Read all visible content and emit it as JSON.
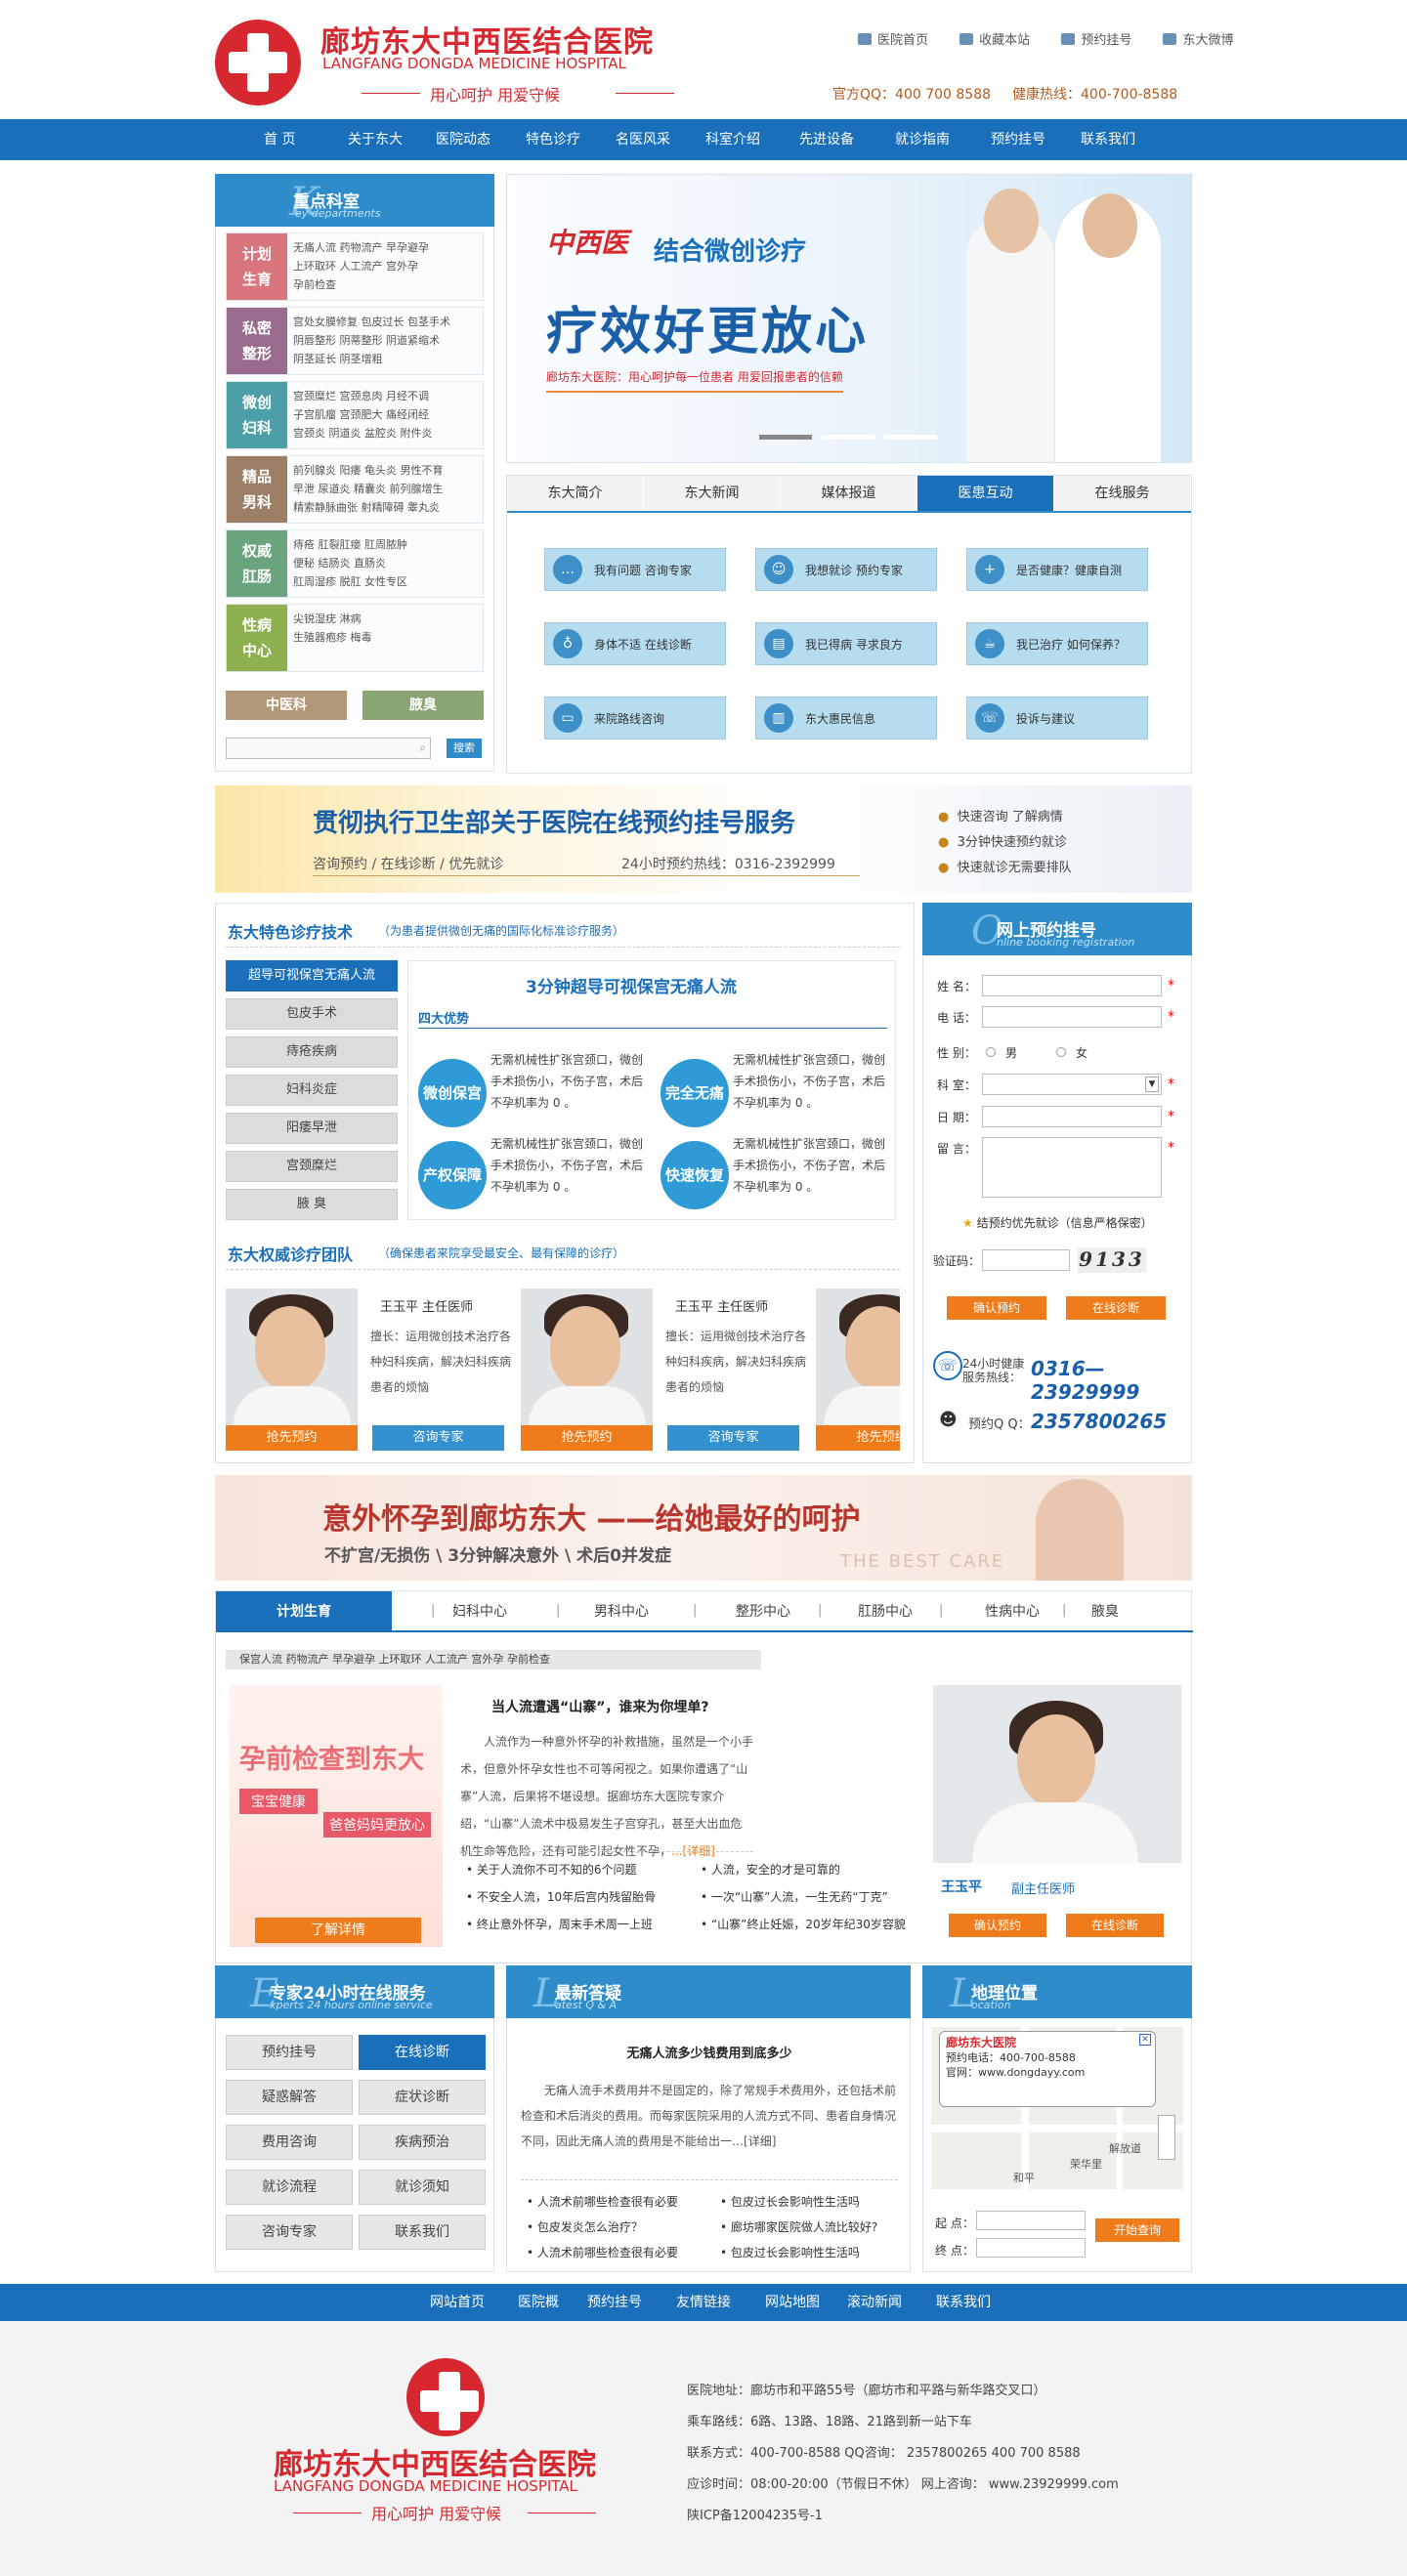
{
  "header": {
    "logo_cn": "廊坊东大中西医结合医院",
    "logo_en": "LANGFANG DONGDA  MEDICINE HOSPITAL",
    "slogan": "用心呵护   用爱守候",
    "links": [
      "医院首页",
      "收藏本站",
      "预约挂号",
      "东大微博"
    ],
    "qq": "官方QQ：400 700 8588",
    "hotline": "健康热线：400-700-8588"
  },
  "nav": [
    "首 页",
    "关于东大",
    "医院动态",
    "特色诊疗",
    "名医风采",
    "科室介绍",
    "先进设备",
    "就诊指南",
    "预约挂号",
    "联系我们"
  ],
  "key_depts": {
    "title": "重点科室",
    "letter": "K",
    "en": "ey departments",
    "items": [
      {
        "tag": "计划生育",
        "color": "#d9757d",
        "lines": [
          "无痛人流  药物流产  早孕避孕",
          "上环取环  人工流产  宫外孕",
          "孕前检查"
        ]
      },
      {
        "tag": "私密整形",
        "color": "#9a6b8c",
        "lines": [
          "宫处女膜修复 包皮过长 包茎手术",
          "阴唇整形   阴蒂整形   阴道紧缩术",
          "阴茎延长   阴茎增粗"
        ]
      },
      {
        "tag": "微创妇科",
        "color": "#4ea0a8",
        "lines": [
          "宫颈糜烂   宫颈息肉   月经不调",
          "子宫肌瘤   宫颈肥大   痛经闭经",
          "宫颈炎     阴道炎     盆腔炎     附件炎"
        ]
      },
      {
        "tag": "精品男科",
        "color": "#9b7e63",
        "lines": [
          "前列腺炎 阳痿 龟头炎 男性不育",
          "早泄 尿道炎 精囊炎 前列腺增生",
          "精索静脉曲张 射精障碍 睾丸炎"
        ]
      },
      {
        "tag": "权威肛肠",
        "color": "#6aa47e",
        "lines": [
          "痔疮   肛裂肛瘘   肛周脓肿",
          "便秘   结肠炎     直肠炎",
          "肛周湿疹   脱肛   女性专区"
        ]
      },
      {
        "tag": "性病中心",
        "color": "#8fb04e",
        "lines": [
          "尖锐湿疣   淋病",
          "生殖器疱疹   梅毒"
        ]
      }
    ],
    "btn_zy": "中医科",
    "btn_hx": "腋臭",
    "search_btn": "搜索"
  },
  "banner": {
    "brand": "中西医",
    "line1": "结合微创诊疗",
    "line2": "疗效好更放心",
    "line3": "廊坊东大医院：用心呵护每一位患者    用爱回报患者的信赖"
  },
  "tabs": [
    "东大简介",
    "东大新闻",
    "媒体报道",
    "医患互动",
    "在线服务"
  ],
  "interact": [
    [
      "我有问题  咨询专家",
      "我想就诊  预约专家",
      "是否健康？健康自测"
    ],
    [
      "身体不适  在线诊断",
      "我已得病  寻求良方",
      "我已治疗  如何保养？"
    ],
    [
      "来院路线咨询",
      "东大惠民信息",
      "投诉与建议"
    ]
  ],
  "mid_banner": {
    "title": "贯彻执行卫生部关于医院在线预约挂号服务",
    "sub": "咨询预约   /   在线诊断   /   优先就诊",
    "hot": "24小时预约热线：0316-2392999",
    "bullets": [
      "快速咨询 了解病情",
      "3分钟快速预约就诊",
      "快速就诊无需要排队"
    ]
  },
  "special": {
    "title": "东大特色诊疗技术",
    "sub": "（为患者提供微创无痛的国际化标准诊疗服务）",
    "tabs": [
      "超导可视保宫无痛人流",
      "包皮手术",
      "痔疮疾病",
      "妇科炎症",
      "阳痿早泄",
      "宫颈糜烂",
      "腋    臭"
    ],
    "headline": "3分钟超导可视保宫无痛人流",
    "adv_title": "四大优势",
    "advs": [
      {
        "name": "微创保宫",
        "txt": "无需机械性扩张宫颈口，微创手术损伤小，不伤子宫，术后不孕机率为 0 。"
      },
      {
        "name": "完全无痛",
        "txt": "无需机械性扩张宫颈口，微创手术损伤小，不伤子宫，术后不孕机率为 0 。"
      },
      {
        "name": "产权保障",
        "txt": "无需机械性扩张宫颈口，微创手术损伤小，不伤子宫，术后不孕机率为 0 。"
      },
      {
        "name": "快速恢复",
        "txt": "无需机械性扩张宫颈口，微创手术损伤小，不伤子宫，术后不孕机率为 0 。"
      }
    ]
  },
  "team": {
    "title": "东大权威诊疗团队",
    "sub": "（确保患者来院享受最安全、最有保障的诊疗）",
    "doctors": [
      {
        "name": "王玉平   主任医师",
        "desc": "擅长：运用微创技术治疗各种妇科疾病，解决妇科疾病患者的烦恼"
      },
      {
        "name": "王玉平   主任医师",
        "desc": "擅长：运用微创技术治疗各种妇科疾病，解决妇科疾病患者的烦恼"
      }
    ],
    "btn_book": "抢先预约",
    "btn_consult": "咨询专家"
  },
  "booking": {
    "title": "网上预约挂号",
    "letter": "O",
    "en": "nline booking registration",
    "labels": [
      "姓    名：",
      "电    话：",
      "性    别：",
      "科    室：",
      "日    期：",
      "留    言："
    ],
    "male": "男",
    "female": "女",
    "notice": "结预约优先就诊（信息严格保密）",
    "captcha_label": "验证码：",
    "captcha": "9133",
    "confirm": "确认预约",
    "online": "在线诊断",
    "hot_label": "24小时健康服务热线：",
    "hot_num": "0316—23929999",
    "qq_label": "预约Q Q：",
    "qq_num": "2357800265"
  },
  "care_banner": {
    "title": "意外怀孕到廊坊东大 ——给她最好的呵护",
    "sub": "不扩宫/无损伤    \\    3分钟解决意外    \\    术后0并发症",
    "en": "THE BEST CARE"
  },
  "dept_tabs": [
    "计划生育",
    "妇科中心",
    "男科中心",
    "整形中心",
    "肛肠中心",
    "性病中心",
    "腋臭"
  ],
  "sub_tags": "保宫人流  药物流产  早孕避孕  上环取环  人工流产  宫外孕  孕前检查",
  "promo": {
    "title": "孕前检查到东大",
    "l1": "宝宝健康",
    "l2": "爸爸妈妈更放心",
    "btn": "了解详情"
  },
  "article": {
    "title": "当人流遭遇“山寨”，谁来为你埋单?",
    "body": "人流作为一种意外怀孕的补救措施，虽然是一个小手术，但意外怀孕女性也不可等闲视之。如果你遭遇了“山寨”人流，后果将不堪设想。据廊坊东大医院专家介绍，“山寨”人流术中极易发生子宫穿孔，甚至大出血危机生命等危险，还有可能引起女性不孕，",
    "more": "...[详细]",
    "links": [
      "关于人流你不可不知的6个问题",
      "人流，安全的才是可靠的",
      "不安全人流，10年后宫内残留胎骨",
      "一次“山寨”人流，一生无药“丁克”",
      "终止意外怀孕，周末手术周一上班",
      "“山寨”终止妊娠，20岁年纪30岁容貌"
    ]
  },
  "doctor_card": {
    "name": "王玉平",
    "title": "副主任医师",
    "btn1": "确认预约",
    "btn2": "在线诊断"
  },
  "service": {
    "title": "专家24小时在线服务",
    "letter": "E",
    "en": "xperts 24 hours online service",
    "items": [
      "预约挂号",
      "在线诊断",
      "疑惑解答",
      "症状诊断",
      "费用咨询",
      "疾病预治",
      "就诊流程",
      "就诊须知",
      "咨询专家",
      "联系我们"
    ]
  },
  "qa": {
    "title": "最新答疑",
    "letter": "L",
    "en": "atest Q & A",
    "q": "无痛人流多少钱费用到底多少",
    "body": "无痛人流手术费用并不是固定的，除了常规手术费用外，还包括术前检查和术后消炎的费用。而每家医院采用的人流方式不同、患者自身情况不同，因此无痛人流的费用是不能给出一…",
    "more": "[详细]",
    "links": [
      "人流术前哪些检查很有必要",
      "包皮过长会影响性生活吗",
      "包皮发炎怎么治疗？",
      "廊坊哪家医院做人流比较好?",
      "人流术前哪些检查很有必要",
      "包皮过长会影响性生活吗"
    ]
  },
  "location": {
    "title": "地理位置",
    "letter": "L",
    "en": "ocation",
    "popup_title": "廊坊东大医院",
    "popup_tel": "预约电话：400-700-8588",
    "popup_web": "官网：www.dongdayy.com",
    "road1": "解放道",
    "road2": "荣华里",
    "road3": "和平",
    "start": "起  点：",
    "end": "终  点：",
    "btn": "开始查询"
  },
  "footer": {
    "nav": [
      "网站首页",
      "医院概",
      "预约挂号",
      "友情链接",
      "网站地图",
      "滚动新闻",
      "联系我们"
    ],
    "lines": [
      "医院地址：廊坊市和平路55号（廊坊市和平路与新华路交叉口）",
      "乘车路线：6路、13路、18路、21路到新一站下车",
      "联系方式：400-700-8588      QQ咨询：  2357800265 400 700 8588",
      "应诊时间：08:00-20:00（节假日不休）  网上咨询：  www.23929999.com",
      "陕ICP备12004235号-1"
    ]
  }
}
